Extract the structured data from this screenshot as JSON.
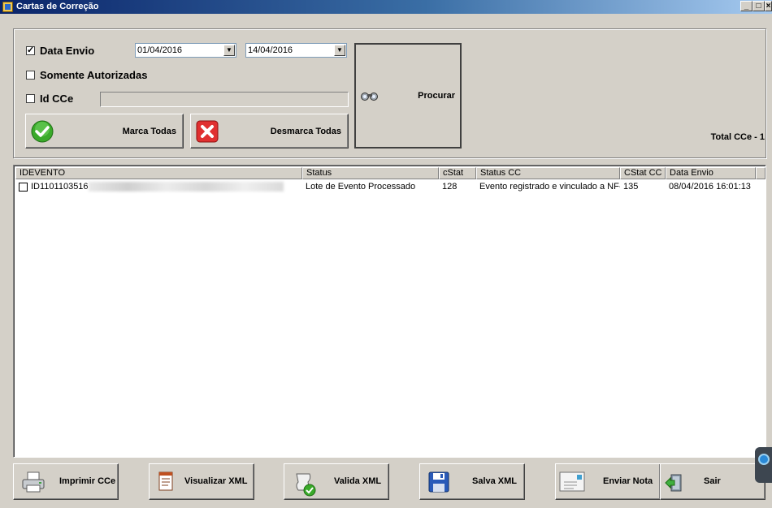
{
  "window": {
    "title": "Cartas de Correção",
    "controls": [
      "_",
      "□",
      "×"
    ]
  },
  "filters": {
    "data_envio": {
      "label": "Data Envio",
      "checked": true,
      "from": "01/04/2016",
      "to": "14/04/2016"
    },
    "somente_autorizadas": {
      "label": "Somente Autorizadas",
      "checked": false
    },
    "id_cce": {
      "label": "Id CCe",
      "checked": false,
      "value": ""
    }
  },
  "buttons": {
    "marca_todas": "Marca Todas",
    "desmarca_todas": "Desmarca Todas",
    "procurar": "Procurar"
  },
  "total": "Total CCe - 1",
  "list": {
    "columns": [
      "IDEVENTO",
      "Status",
      "cStat",
      "Status CC",
      "CStat CC",
      "Data Envio"
    ],
    "rows": [
      {
        "checked": false,
        "idevento": "ID1101103516",
        "status": "Lote de Evento Processado",
        "cstat": "128",
        "status_cc": "Evento registrado e vinculado a NF-e",
        "cstat_cc": "135",
        "data_envio": "08/04/2016 16:01:13"
      }
    ]
  },
  "footer": {
    "imprimir": "Imprimir CCe",
    "visualizar": "Visualizar XML",
    "valida": "Valida XML",
    "salva": "Salva XML",
    "enviar": "Enviar Nota",
    "sair": "Sair"
  },
  "icons": [
    "app-icon",
    "binoculars-icon",
    "check-icon",
    "x-icon",
    "printer-icon",
    "document-icon",
    "xml-check-icon",
    "floppy-icon",
    "envelope-icon",
    "exit-icon",
    "teamviewer-icon"
  ]
}
